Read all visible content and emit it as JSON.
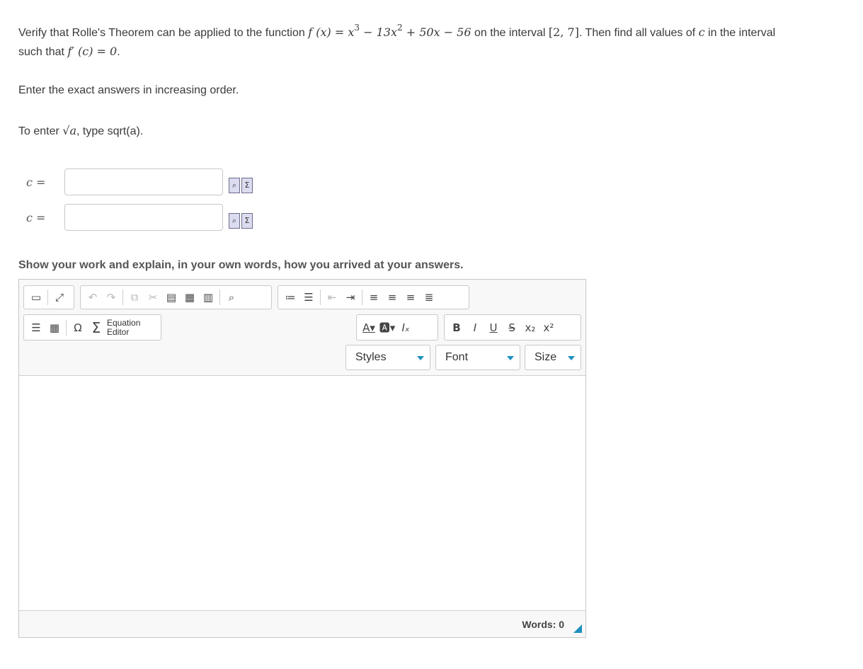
{
  "question": {
    "line1_prefix": "Verify that Rolle's Theorem can be applied to the function ",
    "function_expr": "f (x) = x³ − 13x² + 50x − 56",
    "line1_mid": " on the interval ",
    "interval": "[2, 7]",
    "line1_mid2": ". Then find all values of ",
    "var_c": "c",
    "line1_suffix": " in the interval",
    "line2_prefix": "such that ",
    "derivative_expr": "f′ (c) = 0",
    "line2_suffix": ".",
    "instruction": "Enter the exact answers in increasing order.",
    "hint_prefix": "To enter ",
    "hint_math": "√a",
    "hint_suffix": ", type sqrt(a)."
  },
  "answers": [
    {
      "label": "c =",
      "value": ""
    },
    {
      "label": "c =",
      "value": ""
    }
  ],
  "work_prompt": "Show your work and explain, in your own words, how you arrived at your answers.",
  "editor": {
    "equation_label_line1": "Equation",
    "equation_label_line2": "Editor",
    "styles_label": "Styles",
    "font_label": "Font",
    "size_label": "Size",
    "words_label": "Words: 0",
    "accent_color": "#1f8fbf"
  }
}
